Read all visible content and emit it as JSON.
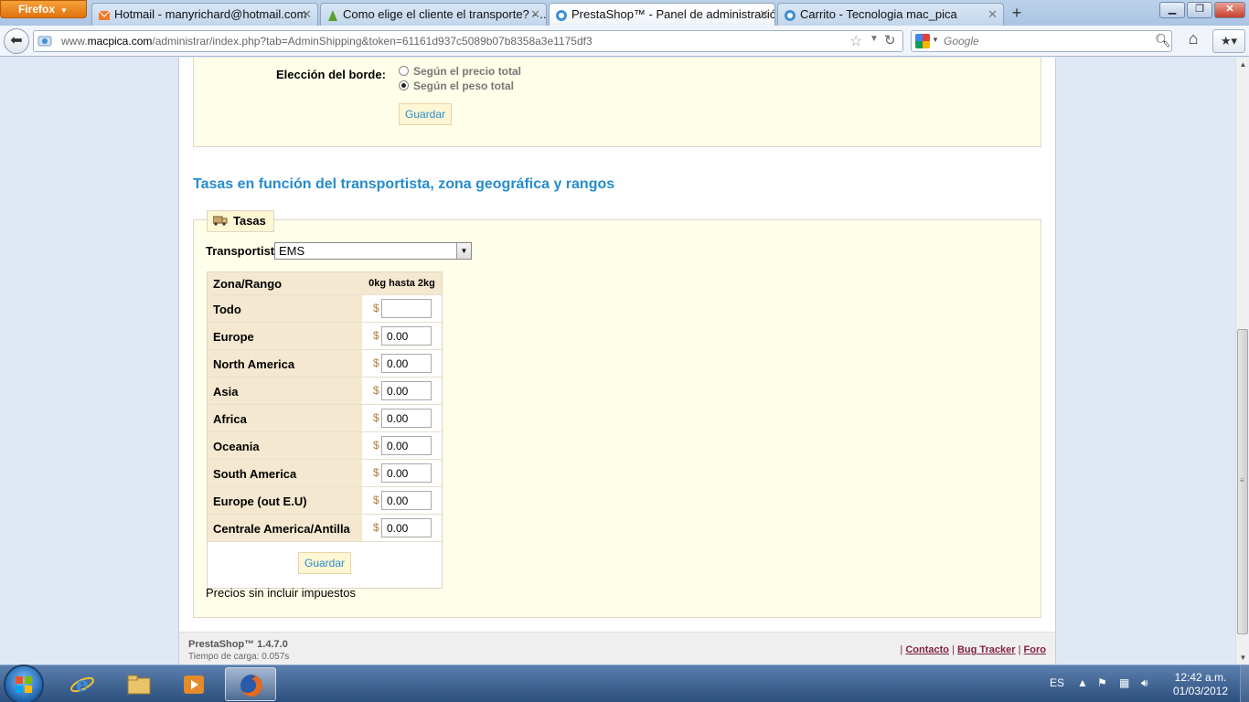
{
  "browser": {
    "menu_button": "Firefox",
    "tabs": [
      {
        "title": "Hotmail - manyrichard@hotmail.com",
        "active": false
      },
      {
        "title": "Como elige el cliente el transporte? - ...",
        "active": false
      },
      {
        "title": "PrestaShop™ - Panel de administración",
        "active": true
      },
      {
        "title": "Carrito - Tecnologia mac_pica",
        "active": false
      }
    ],
    "new_tab": "+",
    "url_domain": "www.macpica.com",
    "url_prefix": "www.",
    "url_host": "macpica.com",
    "url_path": "/administrar/index.php?tab=AdminShipping&token=61161d937c5089b07b8358a3e1175df3",
    "search_placeholder": "Google"
  },
  "border_section": {
    "label": "Elección del borde:",
    "options": [
      {
        "label": "Según el precio total",
        "checked": false
      },
      {
        "label": "Según el peso total",
        "checked": true
      }
    ],
    "save_label": "Guardar"
  },
  "rates_section": {
    "title": "Tasas en función del transportista, zona geográfica y rangos",
    "legend": "Tasas",
    "carrier_label": "Transportista:",
    "carrier_value": "EMS",
    "table": {
      "col_zone": "Zona/Rango",
      "col_range": "0kg hasta 2kg",
      "currency": "$",
      "rows": [
        {
          "zone": "Todo",
          "value": ""
        },
        {
          "zone": "Europe",
          "value": "0.00"
        },
        {
          "zone": "North America",
          "value": "0.00"
        },
        {
          "zone": "Asia",
          "value": "0.00"
        },
        {
          "zone": "Africa",
          "value": "0.00"
        },
        {
          "zone": "Oceania",
          "value": "0.00"
        },
        {
          "zone": "South America",
          "value": "0.00"
        },
        {
          "zone": "Europe (out E.U)",
          "value": "0.00"
        },
        {
          "zone": "Centrale America/Antilla",
          "value": "0.00"
        }
      ]
    },
    "save_label": "Guardar",
    "note": "Precios sin incluir impuestos"
  },
  "footer": {
    "version": "PrestaShop™ 1.4.7.0",
    "load_time": "Tiempo de carga: 0.057s",
    "sep": "|",
    "links": [
      "Contacto",
      "Bug Tracker",
      "Foro"
    ]
  },
  "taskbar": {
    "language": "ES",
    "time": "12:42 a.m.",
    "date": "01/03/2012"
  },
  "colors": {
    "accent_blue": "#268ccd",
    "panel_bg": "#ffffe9",
    "zone_bg": "#f4e8d0",
    "link_color": "#812143"
  }
}
